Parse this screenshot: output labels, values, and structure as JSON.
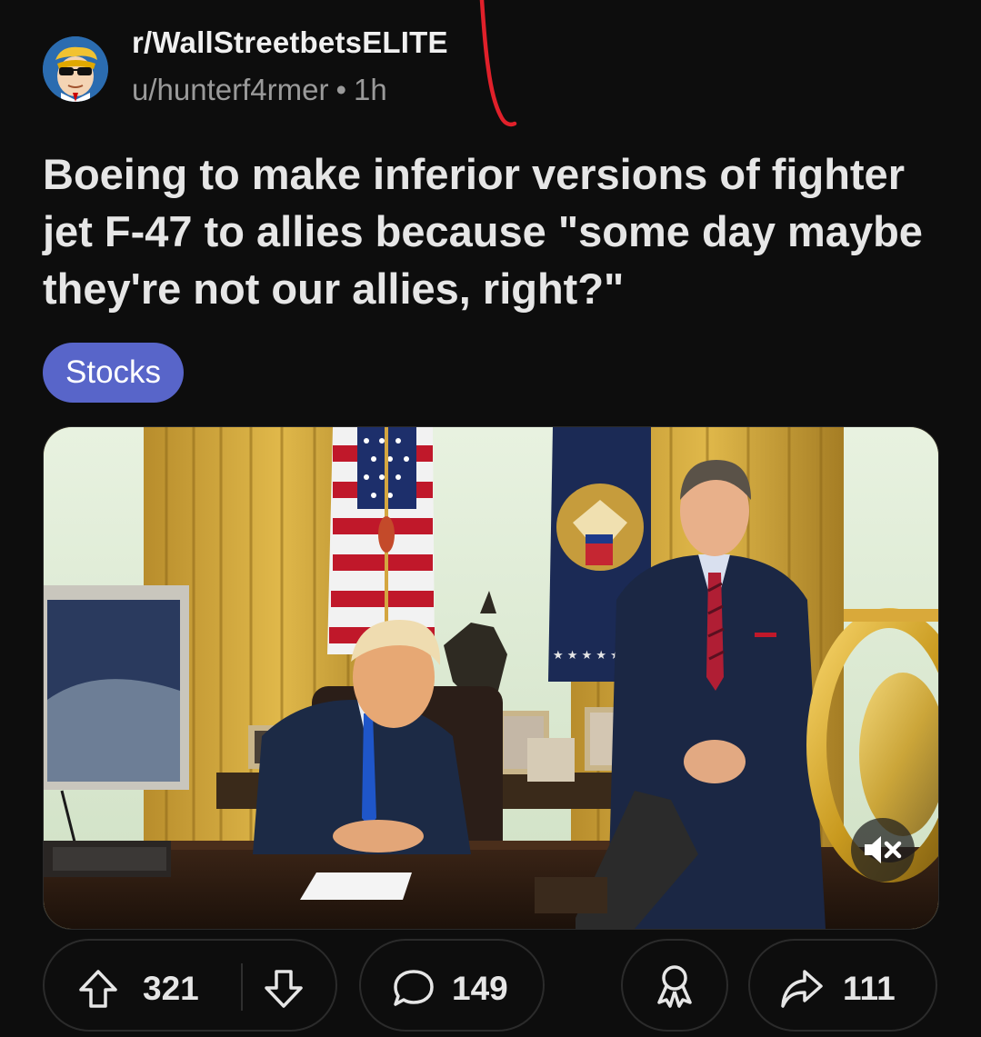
{
  "post": {
    "subreddit": "r/WallStreetbetsELITE",
    "author": "u/hunterf4rmer",
    "separator": "•",
    "age": "1h",
    "title": "Boeing to make inferior versions of fighter jet F-47 to allies because \"some day maybe they're not our allies, right?\"",
    "flair": "Stocks"
  },
  "media": {
    "type": "video",
    "muted": true,
    "avatar_icon": "sunglasses-character-icon"
  },
  "actions": {
    "upvotes": "321",
    "comments": "149",
    "shares": "111"
  },
  "colors": {
    "background": "#0d0d0d",
    "flair": "#5865c9",
    "annotation_stroke": "#e0202a"
  }
}
